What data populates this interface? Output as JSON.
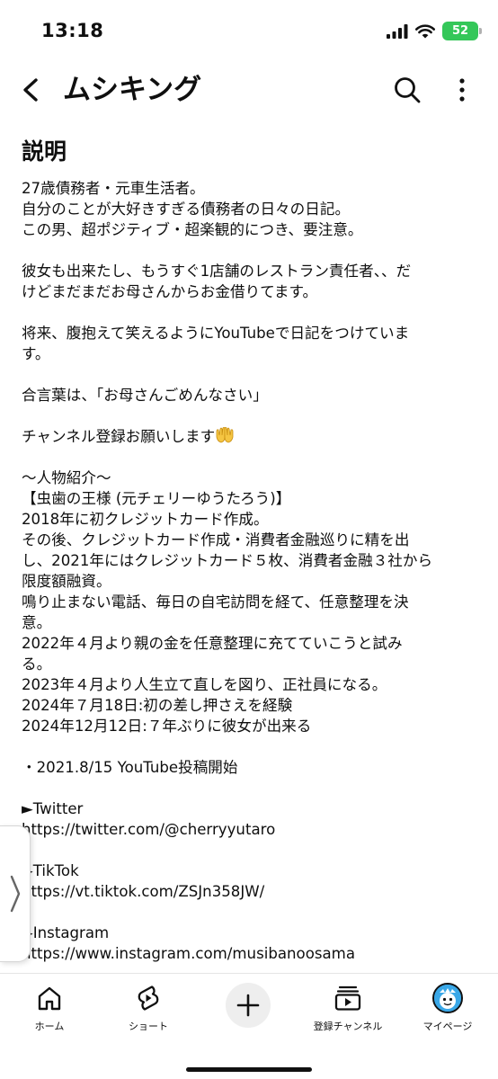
{
  "status_bar": {
    "time": "13:18",
    "battery": "52",
    "icons": [
      "signal-icon",
      "wifi-icon",
      "battery-icon"
    ]
  },
  "header": {
    "title": "ムシキング",
    "icons": [
      "back-arrow-icon",
      "search-icon",
      "more-vertical-icon"
    ]
  },
  "description": {
    "heading": "説明",
    "lines": [
      "27歳債務者・元車生活者。",
      "自分のことが大好きすぎる債務者の日々の日記。",
      "この男、超ポジティブ・超楽観的につき、要注意。",
      "",
      "彼女も出来たし、もうすぐ1店舗のレストラン責任者、、だ",
      "けどまだまだお母さんからお金借りてます。",
      "",
      "将来、腹抱えて笑えるようにYouTubeで日記をつけていま",
      "す。",
      "",
      "合言葉は、「お母さんごめんなさい」",
      "",
      "チャンネル登録お願いします",
      "",
      "〜人物紹介〜",
      "【虫歯の王様 (元チェリーゆうたろう)】",
      "2018年に初クレジットカード作成。",
      "その後、クレジットカード作成・消費者金融巡りに精を出",
      "し、2021年にはクレジットカード５枚、消費者金融３社から",
      "限度額融資。",
      "鳴り止まない電話、毎日の自宅訪問を経て、任意整理を決",
      "意。",
      "2022年４月より親の金を任意整理に充てていこうと試み",
      "る。",
      "2023年４月より人生立て直しを図り、正社員になる。",
      "2024年７月18日:初の差し押さえを経験",
      "2024年12月12日:７年ぶりに彼女が出来る",
      "",
      "・2021.8/15 YouTube投稿開始",
      "",
      "►Twitter",
      "https://twitter.com/@cherryyutaro",
      "",
      "►TikTok",
      "https://vt.tiktok.com/ZSJn358JW/",
      "",
      "►Instagram",
      "https://www.instagram.com/musibanoosama"
    ],
    "emoji_after_line": 12,
    "emoji_name": "palms-up-together-emoji"
  },
  "side_handle": {
    "icon": "chevron-right-icon"
  },
  "bottom_nav": {
    "items": [
      {
        "label": "ホーム",
        "icon": "home-icon"
      },
      {
        "label": "ショート",
        "icon": "shorts-icon"
      },
      {
        "label": "",
        "icon": "create-plus-icon"
      },
      {
        "label": "登録チャンネル",
        "icon": "subscriptions-icon"
      },
      {
        "label": "マイページ",
        "icon": "avatar-icon"
      }
    ]
  },
  "colors": {
    "text": "#0f0f0f",
    "battery": "#34c759",
    "avatar_bg": "#3aa8e8",
    "emoji": "#f5c542"
  }
}
